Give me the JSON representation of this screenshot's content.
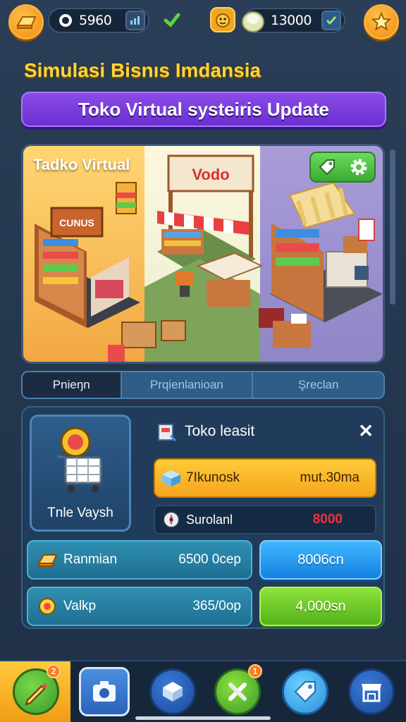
{
  "topbar": {
    "coins_value": "5960",
    "gems_value": "13000"
  },
  "header": {
    "title": "Simulasi Bisnıs Imdansia",
    "banner": "Toko Virtual systeiris Update"
  },
  "scene": {
    "label": "Tadko Virtual"
  },
  "tabs": [
    {
      "label": "Pnieŋn",
      "active": true
    },
    {
      "label": "Prqienlanioan",
      "active": false
    },
    {
      "label": "Şreclan",
      "active": false
    }
  ],
  "panel": {
    "card_label": "Tnle Vaysh",
    "title": "Toko leasit",
    "close": "✕",
    "orange_row": {
      "left": "7Ikunosk",
      "right": "mut.30ma"
    },
    "dark_row": {
      "left": "Surolanl",
      "right": "8000"
    },
    "stats": [
      {
        "label": "Ranmian",
        "value": "6500 0сер",
        "button": "8006cn",
        "button_color": "#1680e0"
      },
      {
        "label": "Valkp",
        "value": "365/0op",
        "button": "4,000sn",
        "button_color": "#54b21a"
      }
    ]
  },
  "bottom_nav": {
    "items": [
      {
        "icon": "pencil-icon",
        "badge": "2"
      },
      {
        "icon": "camera-icon"
      },
      {
        "icon": "box-icon"
      },
      {
        "icon": "tools-icon",
        "badge": "1"
      },
      {
        "icon": "tag-icon"
      },
      {
        "icon": "shop-icon"
      }
    ]
  },
  "colors": {
    "accent_yellow": "#ffd43b",
    "banner_purple": "#6b2fd0",
    "button_blue": "#1680e0",
    "button_green": "#54b21a",
    "background": "#253850"
  }
}
